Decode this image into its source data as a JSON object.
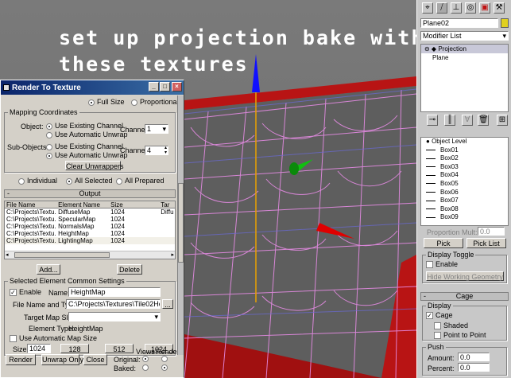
{
  "caption": {
    "line1": "set up projection bake with",
    "line2": "these textures"
  },
  "dialog": {
    "title": "Render To Texture",
    "title_buttons": {
      "minimize": "_",
      "maximize": "□",
      "close": "×"
    },
    "size_options": {
      "full": "Full Size",
      "proportional": "Proportional"
    },
    "mapping": {
      "group_label": "Mapping Coordinates",
      "object_label": "Object:",
      "sub_objects_label": "Sub-Objects:",
      "use_existing": "Use Existing Channel",
      "use_auto": "Use Automatic Unwrap",
      "channel_label": "Channel:",
      "object_channel": "1",
      "sub_channel": "4",
      "clear_button": "Clear Unwrappers"
    },
    "select_options": {
      "individual": "Individual",
      "all_selected": "All Selected",
      "all_prepared": "All Prepared"
    },
    "output": {
      "header": "Output",
      "columns": [
        "File Name",
        "Element Name",
        "Size",
        "Tar"
      ],
      "rows": [
        {
          "file": "C:\\Projects\\Textu...",
          "element": "DiffuseMap",
          "size": "1024",
          "target": "Diffu"
        },
        {
          "file": "C:\\Projects\\Textu...",
          "element": "SpecularMap",
          "size": "1024",
          "target": ""
        },
        {
          "file": "C:\\Projects\\Textu...",
          "element": "NormalsMap",
          "size": "1024",
          "target": ""
        },
        {
          "file": "C:\\Projects\\Textu...",
          "element": "HeightMap",
          "size": "1024",
          "target": ""
        },
        {
          "file": "C:\\Projects\\Textu...",
          "element": "LightingMap",
          "size": "1024",
          "target": ""
        }
      ],
      "add_button": "Add...",
      "delete_button": "Delete"
    },
    "element": {
      "group_label": "Selected Element Common Settings",
      "enable_label": "Enable",
      "name_label": "Name:",
      "name_value": "HeightMap",
      "file_type_label": "File Name and Type:",
      "file_value": "C:\\Projects\\Textures\\Tile02HeightM",
      "browse": "...",
      "target_slot_label": "Target Map Slot:",
      "element_type_label": "Element Type:",
      "element_type_value": "HeightMap",
      "auto_size_label": "Use Automatic Map Size",
      "size_label": "Size",
      "size_value": "1024",
      "size_presets": [
        "128",
        "512",
        "1024"
      ]
    },
    "footer": {
      "render": "Render",
      "unwrap_only": "Unwrap Only",
      "close": "Close",
      "original_label": "Original:",
      "baked_label": "Baked:",
      "views_label": "Views",
      "render_label": "Render"
    }
  },
  "command_panel": {
    "object_name": "Plane02",
    "modifier_list": "Modifier List",
    "stack": [
      "Projection",
      "Plane"
    ],
    "objects": [
      "Object Level",
      "Box01",
      "Box02",
      "Box03",
      "Box04",
      "Box05",
      "Box06",
      "Box07",
      "Box08",
      "Box09"
    ],
    "proportion_label": "Proportion Mult:",
    "proportion_value": "0.0",
    "pick": "Pick",
    "pick_list": "Pick List",
    "display_toggle": {
      "label": "Display Toggle",
      "enable": "Enable",
      "hide_button": "Hide Working Geometry"
    },
    "cage": {
      "header": "Cage",
      "display_label": "Display",
      "cage": "Cage",
      "shaded": "Shaded",
      "point_to_point": "Point to Point"
    },
    "push": {
      "label": "Push",
      "amount_label": "Amount:",
      "amount_value": "0.0",
      "percent_label": "Percent:",
      "percent_value": "0.0"
    }
  }
}
